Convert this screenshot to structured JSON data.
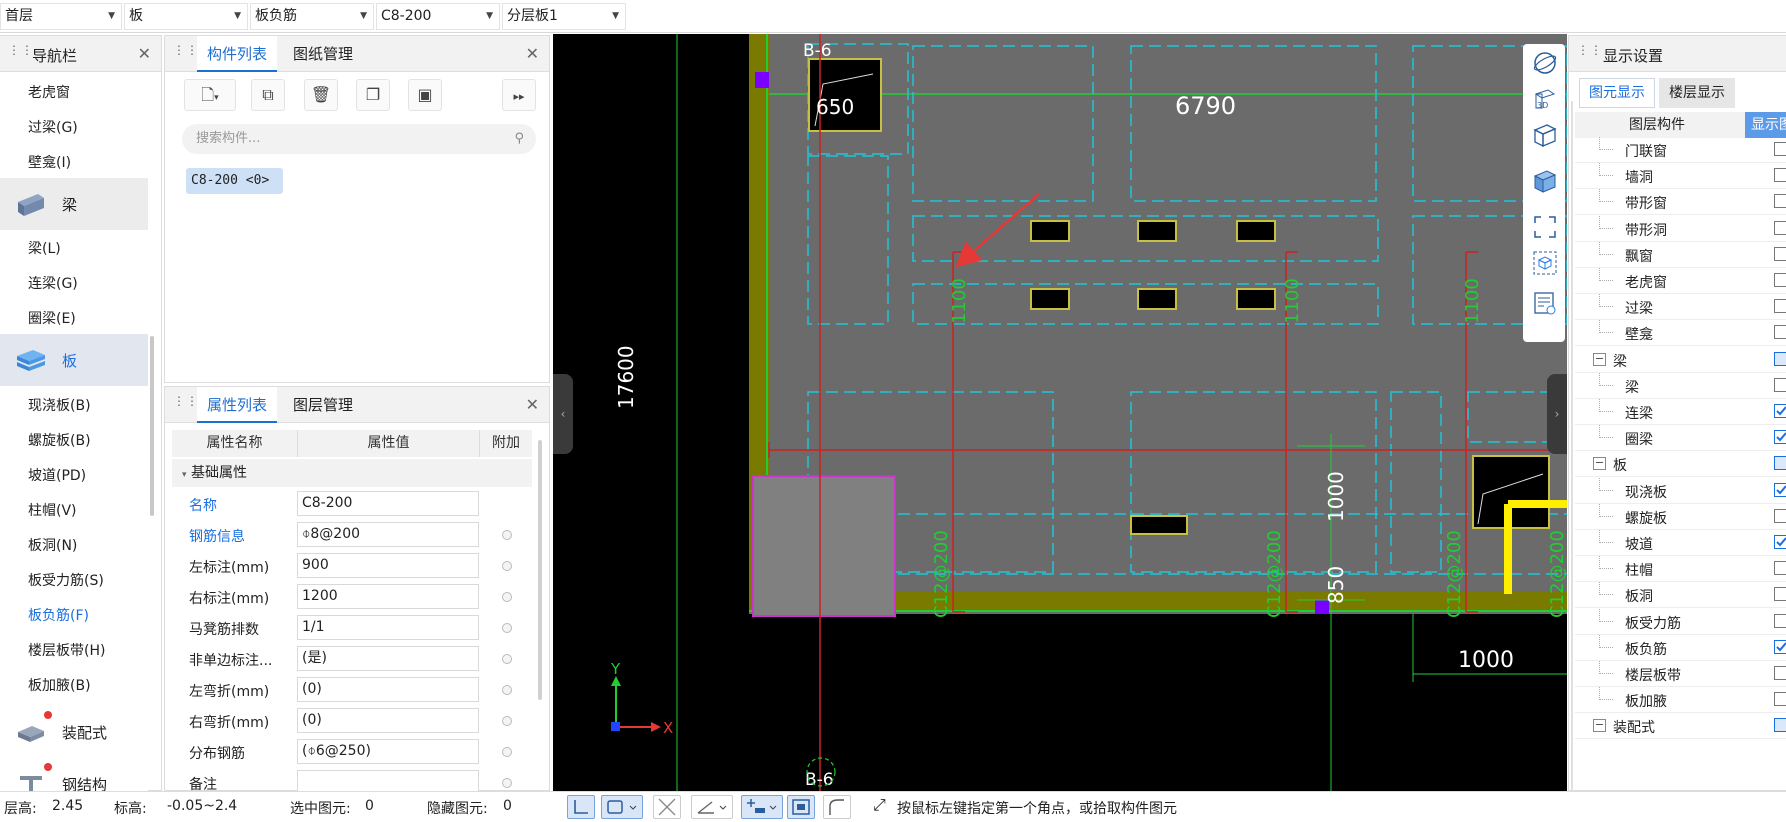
{
  "topbar": {
    "dropdowns": [
      "首层",
      "板",
      "板负筋",
      "C8-200",
      "分层板1"
    ]
  },
  "nav_panel": {
    "title": "导航栏",
    "items_top": [
      "老虎窗",
      "过梁(G)",
      "壁龛(I)"
    ],
    "group_beam": "梁",
    "items_beam": [
      "梁(L)",
      "连梁(G)",
      "圈梁(E)"
    ],
    "group_slab": "板",
    "items_slab": [
      "现浇板(B)",
      "螺旋板(B)",
      "坡道(PD)",
      "柱帽(V)",
      "板洞(N)",
      "板受力筋(S)",
      "板负筋(F)",
      "楼层板带(H)",
      "板加腋(B)"
    ],
    "group_prefab": "装配式",
    "group_steel": "钢结构"
  },
  "component_panel": {
    "tab_active": "构件列表",
    "tab_other": "图纸管理",
    "search_placeholder": "搜索构件...",
    "chip": "C8-200 <0>"
  },
  "property_panel": {
    "tab_active": "属性列表",
    "tab_other": "图层管理",
    "col_name": "属性名称",
    "col_value": "属性值",
    "col_extra": "附加",
    "section": "基础属性",
    "rows": [
      {
        "name": "名称",
        "value": "C8-200"
      },
      {
        "name": "钢筋信息",
        "value": "⌽8@200"
      },
      {
        "name": "左标注(mm)",
        "value": "900"
      },
      {
        "name": "右标注(mm)",
        "value": "1200"
      },
      {
        "name": "马凳筋排数",
        "value": "1/1"
      },
      {
        "name": "非单边标注...",
        "value": "(是)"
      },
      {
        "name": "左弯折(mm)",
        "value": "(0)"
      },
      {
        "name": "右弯折(mm)",
        "value": "(0)"
      },
      {
        "name": "分布钢筋",
        "value": "(⌽6@250)"
      },
      {
        "name": "备注",
        "value": ""
      }
    ]
  },
  "canvas": {
    "labels": {
      "axis_top": "B-6",
      "axis_bottom": "B-6",
      "dim_650": "650",
      "dim_6790": "6790",
      "dim_17600": "17600",
      "dim_1100": "1100",
      "dim_1000v": "1000",
      "dim_850": "850",
      "dim_1000h": "1000",
      "rebar": "C12@200",
      "axis_x": "X",
      "axis_y": "Y"
    },
    "colors": {
      "background": "#000000",
      "slab": "#6b6b6b",
      "edge": "#7a7a00",
      "dashed": "#21c4d9",
      "rebar_line": "#cc2222",
      "dimension": "#22cc33",
      "opening": "#c8c040"
    }
  },
  "display_panel": {
    "title": "显示设置",
    "tab_active": "图元显示",
    "tab_other": "楼层显示",
    "col_component": "图层构件",
    "col_show": "显示图",
    "rows": [
      {
        "label": "门联窗",
        "state": "unchecked"
      },
      {
        "label": "墙洞",
        "state": "unchecked"
      },
      {
        "label": "带形窗",
        "state": "unchecked"
      },
      {
        "label": "带形洞",
        "state": "unchecked"
      },
      {
        "label": "飘窗",
        "state": "unchecked"
      },
      {
        "label": "老虎窗",
        "state": "unchecked"
      },
      {
        "label": "过梁",
        "state": "unchecked"
      },
      {
        "label": "壁龛",
        "state": "unchecked"
      },
      {
        "label": "梁",
        "state": "partial",
        "group": true
      },
      {
        "label": "梁",
        "state": "unchecked"
      },
      {
        "label": "连梁",
        "state": "checked"
      },
      {
        "label": "圈梁",
        "state": "checked"
      },
      {
        "label": "板",
        "state": "partial",
        "group": true
      },
      {
        "label": "现浇板",
        "state": "checked"
      },
      {
        "label": "螺旋板",
        "state": "unchecked"
      },
      {
        "label": "坡道",
        "state": "checked"
      },
      {
        "label": "柱帽",
        "state": "unchecked"
      },
      {
        "label": "板洞",
        "state": "unchecked"
      },
      {
        "label": "板受力筋",
        "state": "unchecked"
      },
      {
        "label": "板负筋",
        "state": "checked"
      },
      {
        "label": "楼层板带",
        "state": "unchecked"
      },
      {
        "label": "板加腋",
        "state": "unchecked"
      },
      {
        "label": "装配式",
        "state": "partial",
        "group": true
      }
    ]
  },
  "statusbar": {
    "floor_height": "层高:",
    "floor_height_val": "2.45",
    "elevation": "标高:",
    "elevation_val": "-0.05~2.4",
    "selected": "选中图元:",
    "selected_val": "0",
    "hidden": "隐藏图元:",
    "hidden_val": "0",
    "hint": "按鼠标左键指定第一个角点，或拾取构件图元"
  }
}
